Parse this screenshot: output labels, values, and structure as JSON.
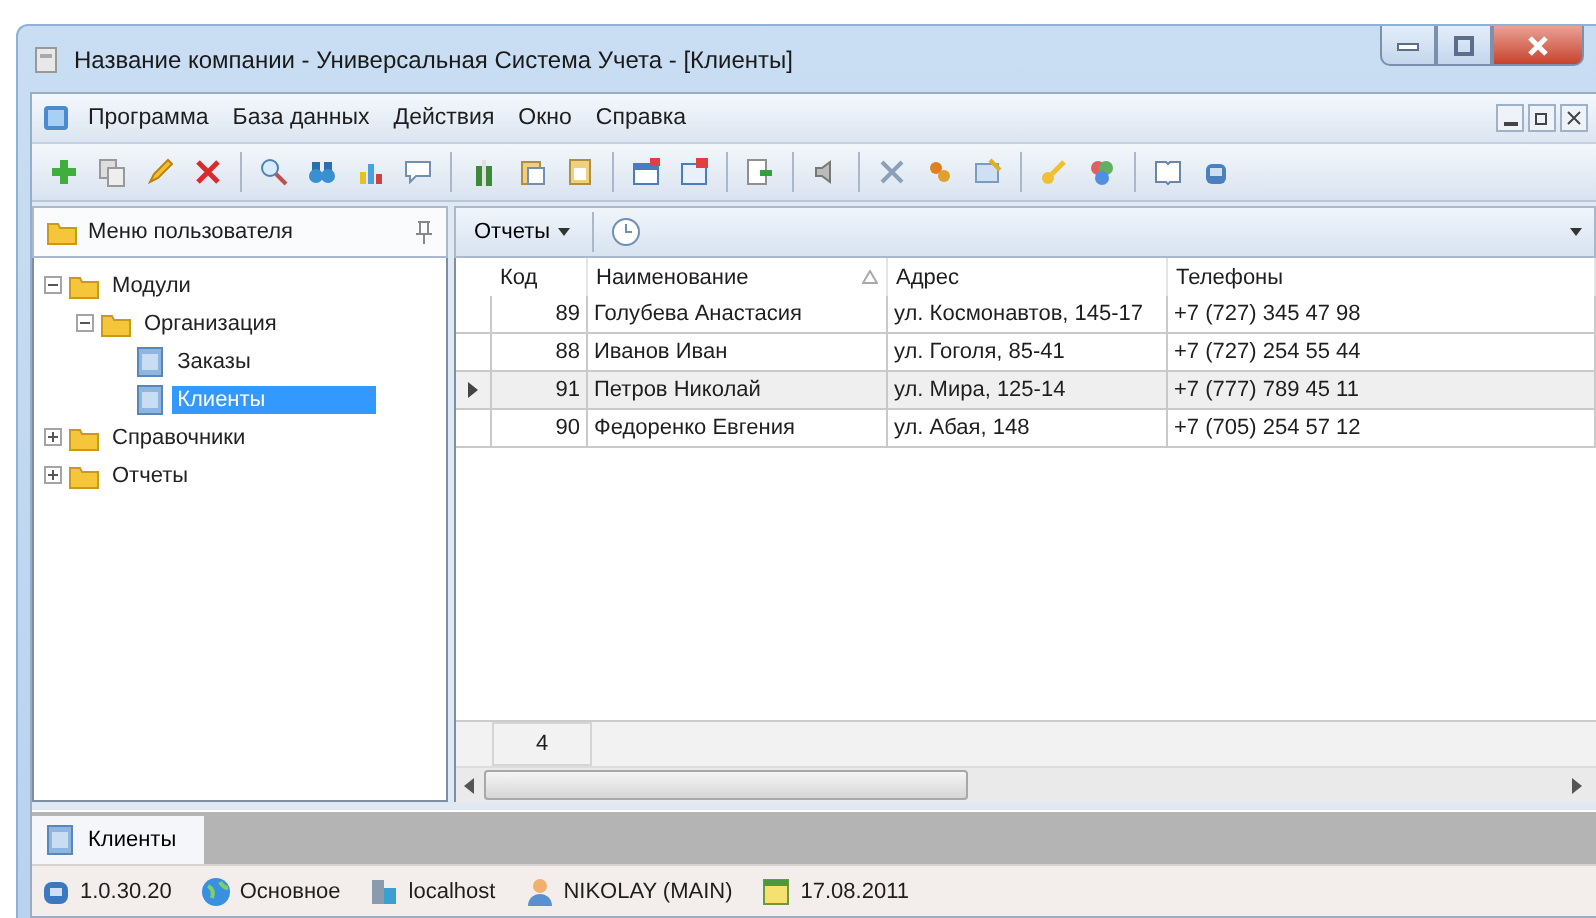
{
  "window": {
    "title": "Название компании - Универсальная Система Учета - [Клиенты]"
  },
  "menu": [
    {
      "label": "Программа"
    },
    {
      "label": "База данных"
    },
    {
      "label": "Действия"
    },
    {
      "label": "Окно"
    },
    {
      "label": "Справка"
    }
  ],
  "sidebar": {
    "title": "Меню пользователя",
    "tree": [
      {
        "label": "Модули",
        "kind": "folder",
        "expanded": true,
        "selected": false,
        "children": [
          {
            "label": "Организация",
            "kind": "folder",
            "expanded": true,
            "selected": false,
            "children": [
              {
                "label": "Заказы",
                "kind": "form",
                "selected": false
              },
              {
                "label": "Клиенты",
                "kind": "form",
                "selected": true
              }
            ]
          }
        ]
      },
      {
        "label": "Справочники",
        "kind": "folder",
        "expanded": false,
        "selected": false
      },
      {
        "label": "Отчеты",
        "kind": "folder",
        "expanded": false,
        "selected": false
      }
    ]
  },
  "grid_toolbar": {
    "reports_button": "Отчеты"
  },
  "table": {
    "columns": [
      {
        "label": "Код",
        "sorted": false
      },
      {
        "label": "Наименование",
        "sorted": true
      },
      {
        "label": "Адрес",
        "sorted": false
      },
      {
        "label": "Телефоны",
        "sorted": false
      }
    ],
    "rows": [
      {
        "cells": [
          "89",
          "Голубева Анастасия",
          "ул. Космонавтов, 145-17",
          "+7 (727) 345 47 98"
        ],
        "selected": false
      },
      {
        "cells": [
          "88",
          "Иванов Иван",
          "ул. Гоголя, 85-41",
          "+7 (727) 254 55 44"
        ],
        "selected": false
      },
      {
        "cells": [
          "91",
          "Петров Николай",
          "ул. Мира, 125-14",
          "+7 (777) 789 45 11"
        ],
        "selected": true
      },
      {
        "cells": [
          "90",
          "Федоренко Евгения",
          "ул. Абая, 148",
          "+7 (705) 254 57 12"
        ],
        "selected": false
      }
    ],
    "footer_count": "4"
  },
  "document_tabs": [
    {
      "label": "Клиенты",
      "selected": true
    }
  ],
  "status_bar": [
    {
      "kind": "version",
      "text": "1.0.30.20"
    },
    {
      "kind": "database",
      "text": "Основное"
    },
    {
      "kind": "server",
      "text": "localhost"
    },
    {
      "kind": "user",
      "text": "NIKOLAY (MAIN)"
    },
    {
      "kind": "date",
      "text": "17.08.2011"
    }
  ]
}
